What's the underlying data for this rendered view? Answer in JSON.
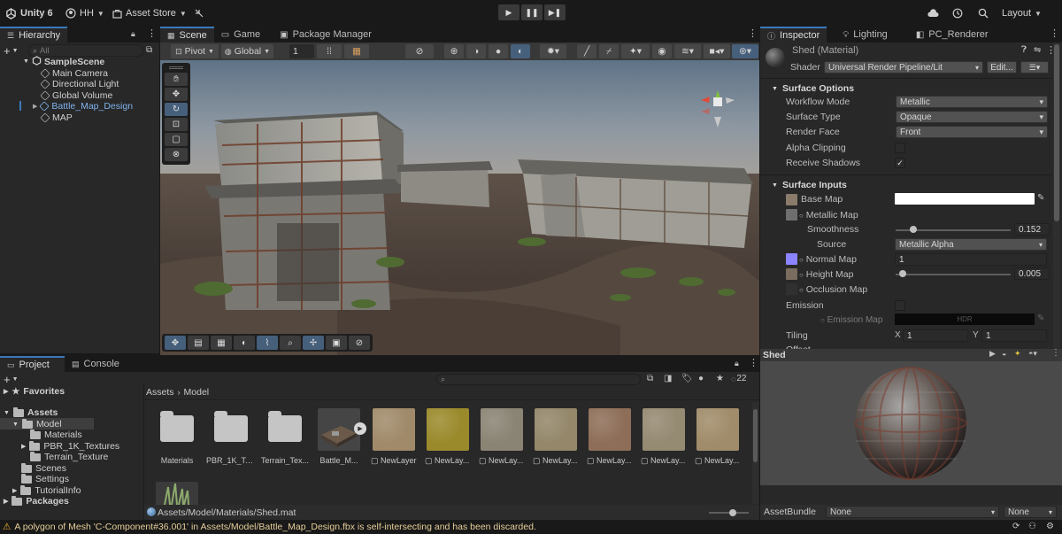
{
  "topbar": {
    "app": "Unity 6",
    "account": "HH",
    "asset_store": "Asset Store",
    "layout": "Layout"
  },
  "tabs_left": [
    "Hierarchy"
  ],
  "tabs_center": [
    "Scene",
    "Game",
    "Package Manager"
  ],
  "tabs_right": [
    "Inspector",
    "Lighting",
    "PC_Renderer"
  ],
  "hierarchy": {
    "search_placeholder": "All",
    "items": [
      {
        "label": "SampleScene",
        "indent": 0,
        "bold": true
      },
      {
        "label": "Main Camera",
        "indent": 1
      },
      {
        "label": "Directional Light",
        "indent": 1
      },
      {
        "label": "Global Volume",
        "indent": 1
      },
      {
        "label": "Battle_Map_Design",
        "indent": 1,
        "selected": true
      },
      {
        "label": "MAP",
        "indent": 1
      }
    ]
  },
  "scene_toolbar": {
    "pivot": "Pivot",
    "global": "Global",
    "grid_value": "1"
  },
  "project": {
    "tabs": [
      "Project",
      "Console"
    ],
    "tree": [
      {
        "label": "Favorites",
        "indent": 0,
        "bold": true
      },
      {
        "label": "Assets",
        "indent": 0,
        "bold": true
      },
      {
        "label": "Model",
        "indent": 1
      },
      {
        "label": "Materials",
        "indent": 2
      },
      {
        "label": "PBR_1K_Textures",
        "indent": 2
      },
      {
        "label": "Terrain_Texture",
        "indent": 2
      },
      {
        "label": "Scenes",
        "indent": 1
      },
      {
        "label": "Settings",
        "indent": 1
      },
      {
        "label": "TutorialInfo",
        "indent": 1
      },
      {
        "label": "Packages",
        "indent": 0,
        "bold": true
      }
    ],
    "breadcrumb": [
      "Assets",
      "Model"
    ],
    "count": "22",
    "assets": [
      {
        "label": "Materials",
        "kind": "folder"
      },
      {
        "label": "PBR_1K_Tex...",
        "kind": "folder"
      },
      {
        "label": "Terrain_Tex...",
        "kind": "folder"
      },
      {
        "label": "Battle_M...",
        "kind": "model"
      },
      {
        "label": "NewLayer",
        "kind": "layer",
        "color": "#a08a6a"
      },
      {
        "label": "NewLay...",
        "kind": "layer",
        "color": "#9a8a2c"
      },
      {
        "label": "NewLay...",
        "kind": "layer",
        "color": "#8a8474"
      },
      {
        "label": "NewLay...",
        "kind": "layer",
        "color": "#94876a"
      },
      {
        "label": "NewLay...",
        "kind": "layer",
        "color": "#8e6e58"
      },
      {
        "label": "NewLay...",
        "kind": "layer",
        "color": "#958a72"
      },
      {
        "label": "NewLay...",
        "kind": "layer",
        "color": "#a08c6a"
      }
    ],
    "path": "Assets/Model/Materials/Shed.mat"
  },
  "inspector": {
    "title": "Shed (Material)",
    "shader_label": "Shader",
    "shader_value": "Universal Render Pipeline/Lit",
    "edit": "Edit...",
    "surface_options": {
      "header": "Surface Options",
      "rows": [
        {
          "label": "Workflow Mode",
          "value": "Metallic"
        },
        {
          "label": "Surface Type",
          "value": "Opaque"
        },
        {
          "label": "Render Face",
          "value": "Front"
        }
      ],
      "alpha_clipping": "Alpha Clipping",
      "receive_shadows": "Receive Shadows"
    },
    "surface_inputs": {
      "header": "Surface Inputs",
      "base_map": "Base Map",
      "metallic_map": "Metallic Map",
      "smoothness": "Smoothness",
      "smoothness_value": "0.152",
      "smoothness_level": 0.152,
      "source": "Source",
      "source_value": "Metallic Alpha",
      "normal_map": "Normal Map",
      "normal_value": "1",
      "height_map": "Height Map",
      "height_value": "0.005",
      "height_level": 0.005,
      "occlusion_map": "Occlusion Map",
      "emission": "Emission",
      "emission_map": "Emission Map",
      "hdr": "HDR",
      "tiling": "Tiling",
      "tiling_x": "1",
      "tiling_y": "1",
      "offset": "Offset",
      "x": "X",
      "y": "Y"
    },
    "preview_title": "Shed",
    "asset_bundle_label": "AssetBundle",
    "asset_bundle_value": "None",
    "asset_bundle_variant": "None"
  },
  "status": {
    "message": "A polygon of Mesh 'C-Component#36.001' in Assets/Model/Battle_Map_Design.fbx is self-intersecting and has been discarded."
  },
  "colors": {
    "accent": "#3a79bb",
    "panel": "#282828",
    "toolbar": "#191919",
    "warning": "#f0b030",
    "normal_map_swatch": "#8c84ff"
  }
}
